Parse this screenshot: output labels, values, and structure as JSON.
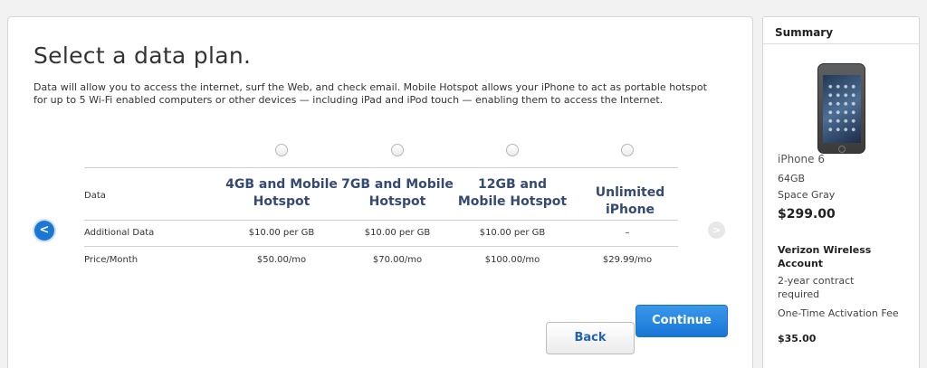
{
  "page": {
    "title": "Select a data plan.",
    "intro": "Data will allow you to access the internet, surf the Web, and check email. Mobile Hotspot allows your iPhone to act as portable hotspot for up to 5 Wi-Fi enabled computers or other devices — including iPad and iPod touch — enabling them to access the Internet."
  },
  "table": {
    "row_labels": [
      "Data",
      "Additional Data",
      "Price/Month"
    ],
    "plans": [
      {
        "name": "4GB and Mobile Hotspot",
        "additional": "$10.00 per GB",
        "price": "$50.00/mo"
      },
      {
        "name": "7GB and Mobile Hotspot",
        "additional": "$10.00 per GB",
        "price": "$70.00/mo"
      },
      {
        "name": "12GB and Mobile Hotspot",
        "additional": "$10.00 per GB",
        "price": "$100.00/mo"
      },
      {
        "name": "Unlimited iPhone",
        "additional": "–",
        "price": "$29.99/mo"
      }
    ]
  },
  "nav": {
    "prev_icon": "chevron-left-icon",
    "next_icon": "chevron-right-icon",
    "prev_glyph": "<",
    "next_glyph": ">"
  },
  "buttons": {
    "back_label": "Back",
    "continue_label": "Continue"
  },
  "summary": {
    "title": "Summary",
    "model": "iPhone 6",
    "capacity": "64GB",
    "color": "Space Gray",
    "price": "$299.00",
    "account_title": "Verizon Wireless Account",
    "contract": "2-year contract required",
    "activation_label": "One-Time Activation Fee",
    "activation_price": "$35.00"
  },
  "colors": {
    "accent": "#1b76d4",
    "plan_name": "#344a73"
  }
}
